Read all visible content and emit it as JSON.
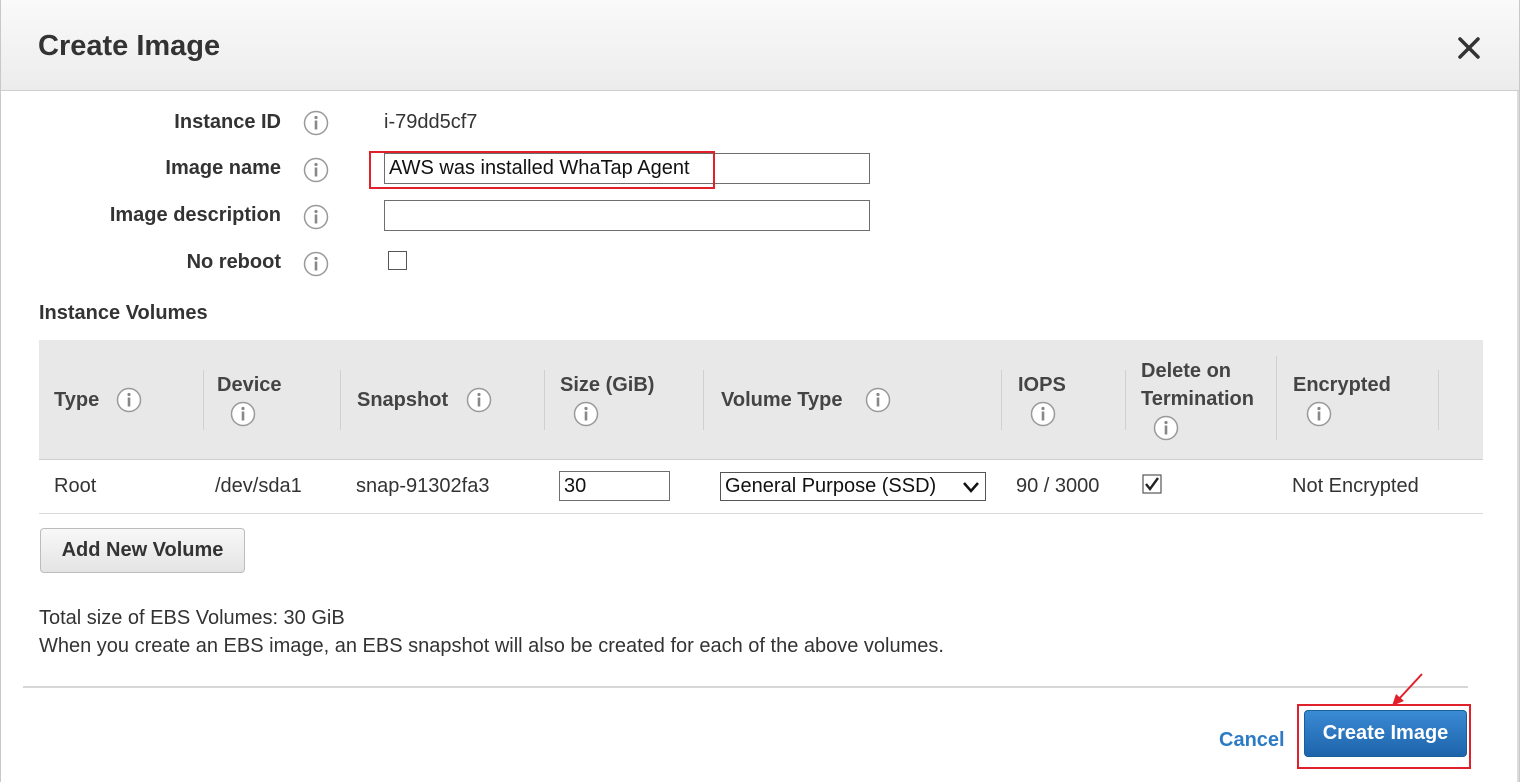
{
  "dialog": {
    "title": "Create Image",
    "close_icon": "close-icon"
  },
  "form": {
    "instance_id_label": "Instance ID",
    "instance_id_value": "i-79dd5cf7",
    "image_name_label": "Image name",
    "image_name_value": "AWS was installed WhaTap Agent",
    "image_description_label": "Image description",
    "image_description_value": "",
    "no_reboot_label": "No reboot",
    "no_reboot_checked": false
  },
  "volumes": {
    "section_title": "Instance Volumes",
    "headers": {
      "type": "Type",
      "device": "Device",
      "snapshot": "Snapshot",
      "size": "Size (GiB)",
      "volume_type": "Volume Type",
      "iops": "IOPS",
      "delete_line1": "Delete on",
      "delete_line2": "Termination",
      "encrypted": "Encrypted"
    },
    "rows": [
      {
        "type": "Root",
        "device": "/dev/sda1",
        "snapshot": "snap-91302fa3",
        "size": "30",
        "volume_type": "General Purpose (SSD)",
        "iops": "90 / 3000",
        "delete_on_termination": true,
        "encrypted": "Not Encrypted"
      }
    ],
    "add_button": "Add New Volume"
  },
  "summary": {
    "total_size": "Total size of EBS Volumes: 30 GiB",
    "note": "When you create an EBS image, an EBS snapshot will also be created for each of the above volumes."
  },
  "footer": {
    "cancel_label": "Cancel",
    "create_label": "Create Image"
  },
  "colors": {
    "primary_button": "#1e64ab",
    "link": "#2d7bc4",
    "annotation_red": "#e0202a"
  }
}
